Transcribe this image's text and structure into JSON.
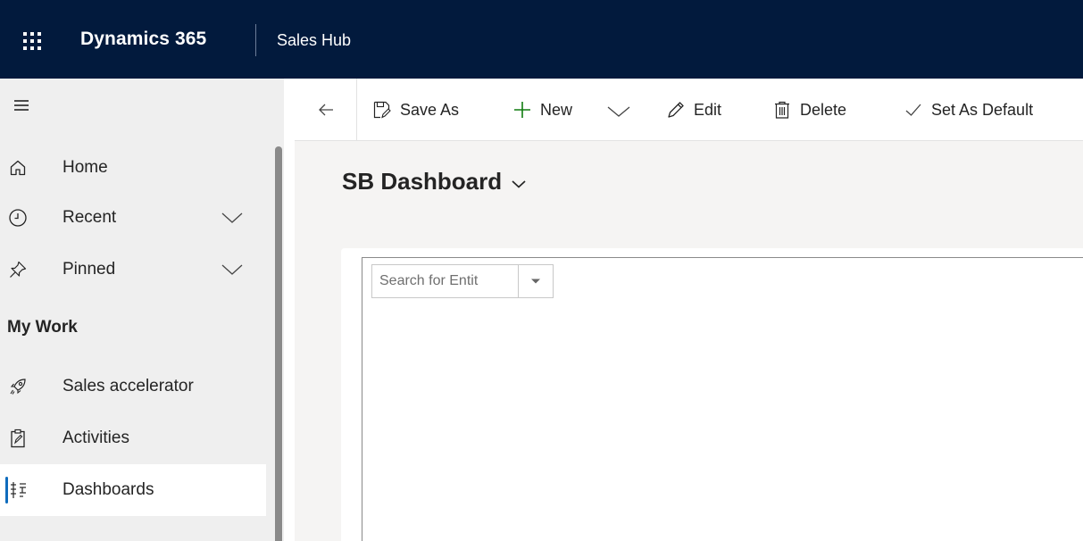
{
  "topbar": {
    "app_name": "Dynamics 365",
    "hub_name": "Sales Hub",
    "waffle_icon": "waffle-icon"
  },
  "sidebar": {
    "items": [
      {
        "label": "Home",
        "icon": "home-icon"
      },
      {
        "label": "Recent",
        "icon": "clock-icon",
        "expandable": true
      },
      {
        "label": "Pinned",
        "icon": "pin-icon",
        "expandable": true
      }
    ],
    "section_title": "My Work",
    "work_items": [
      {
        "label": "Sales accelerator",
        "icon": "rocket-icon"
      },
      {
        "label": "Activities",
        "icon": "clipboard-icon"
      },
      {
        "label": "Dashboards",
        "icon": "dashboard-icon",
        "selected": true
      }
    ]
  },
  "commandbar": {
    "save_as": "Save As",
    "new": "New",
    "edit": "Edit",
    "delete": "Delete",
    "set_default": "Set As Default"
  },
  "dashboard": {
    "title": "SB Dashboard"
  },
  "entity_search": {
    "placeholder": "Search for Entit"
  },
  "colors": {
    "topbar": "#021a3d",
    "selected_accent": "#0f6cbd",
    "new_plus": "#107c10"
  }
}
